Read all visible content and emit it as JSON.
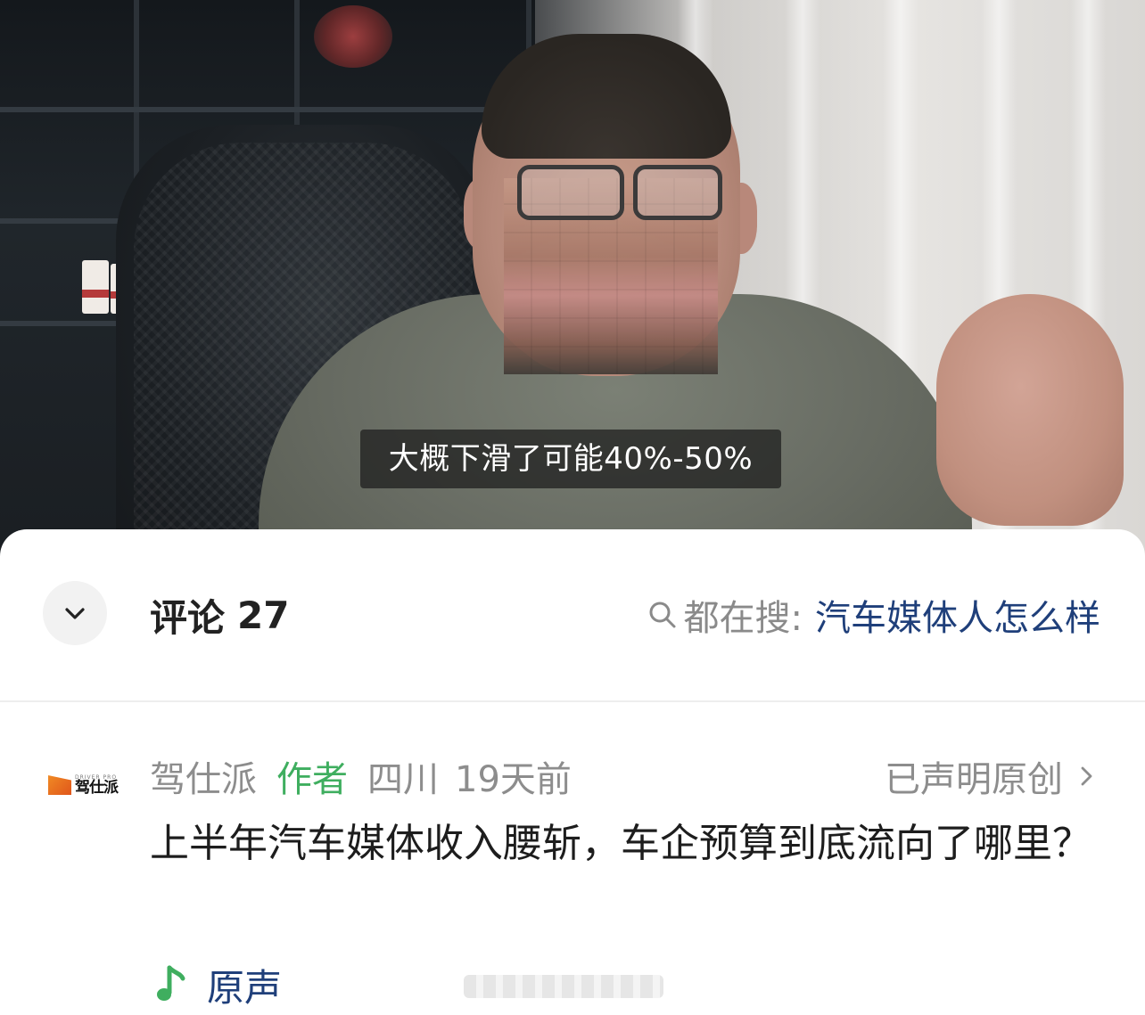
{
  "video": {
    "subtitle": "大概下滑了可能40%-50%"
  },
  "comments_panel": {
    "title": "评论",
    "count": "27",
    "search_prefix": "都在搜:",
    "search_keyword": "汽车媒体人怎么样",
    "colors": {
      "keyword": "#1f3f7a",
      "author_tag": "#3fae5f",
      "meta": "#8d8d8d"
    }
  },
  "post": {
    "avatar": {
      "logo_small": "DRIVER PRO",
      "logo_big": "驾仕派"
    },
    "author": "驾仕派",
    "author_tag": "作者",
    "location": "四川",
    "time": "19天前",
    "original_label": "已声明原创",
    "body": "上半年汽车媒体收入腰斩，车企预算到底流向了哪里？",
    "audio_label": "原声"
  },
  "icons": {
    "collapse": "chevron-down-icon",
    "search": "search-icon",
    "original_arrow": "chevron-right-icon",
    "audio": "music-note-icon"
  }
}
